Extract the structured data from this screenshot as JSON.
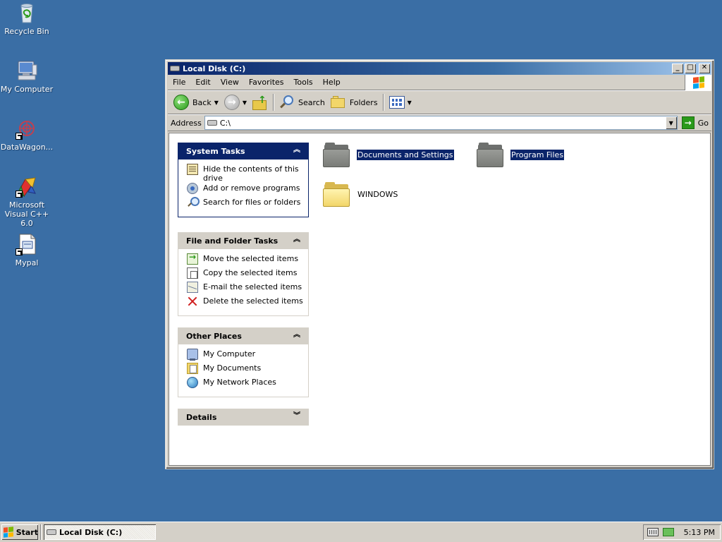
{
  "desktop": {
    "icons": [
      {
        "label": "Recycle Bin",
        "icon": "recycle-bin-icon"
      },
      {
        "label": "My Computer",
        "icon": "computer-icon"
      },
      {
        "label": "DataWagon...",
        "icon": "datawagon-icon"
      },
      {
        "label": "Microsoft Visual C++ 6.0",
        "icon": "visual-cpp-icon"
      },
      {
        "label": "Mypal",
        "icon": "mypal-icon"
      }
    ]
  },
  "window": {
    "title": "Local Disk (C:)",
    "controls": {
      "minimize": "_",
      "maximize": "□",
      "close": "✕"
    },
    "menu": [
      "File",
      "Edit",
      "View",
      "Favorites",
      "Tools",
      "Help"
    ],
    "toolbar": {
      "back": "Back",
      "search": "Search",
      "folders": "Folders"
    },
    "address": {
      "label": "Address",
      "value": "C:\\",
      "go": "Go"
    },
    "panes": {
      "system_tasks": {
        "title": "System Tasks",
        "items": [
          "Hide the contents of this drive",
          "Add or remove programs",
          "Search for files or folders"
        ]
      },
      "file_folder_tasks": {
        "title": "File and Folder Tasks",
        "items": [
          "Move the selected items",
          "Copy the selected items",
          "E-mail the selected items",
          "Delete the selected items"
        ]
      },
      "other_places": {
        "title": "Other Places",
        "items": [
          "My Computer",
          "My Documents",
          "My Network Places"
        ]
      },
      "details": {
        "title": "Details"
      }
    },
    "files": [
      {
        "name": "Documents and Settings",
        "selected": true
      },
      {
        "name": "Program Files",
        "selected": true
      },
      {
        "name": "WINDOWS",
        "selected": false
      }
    ]
  },
  "taskbar": {
    "start": "Start",
    "task": "Local Disk (C:)",
    "clock": "5:13 PM"
  },
  "colors": {
    "desktop": "#3a6ea5",
    "title_active": "#0a246a",
    "selection": "#0a246a"
  }
}
